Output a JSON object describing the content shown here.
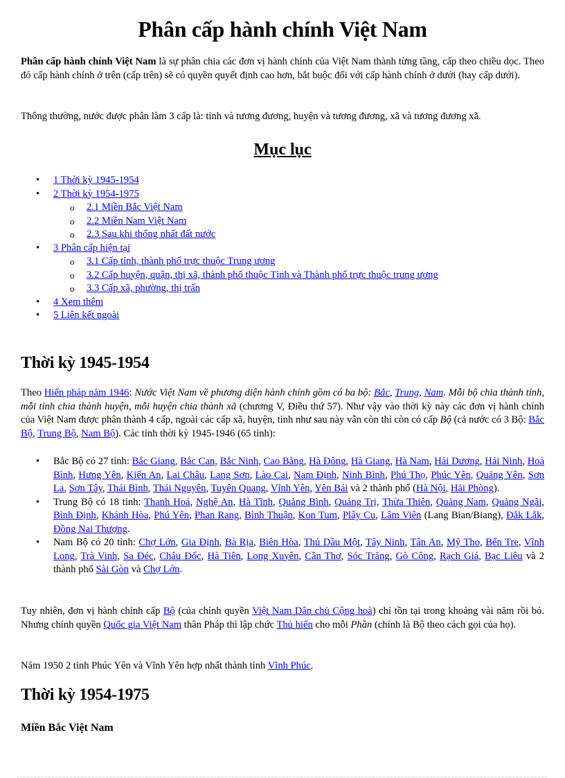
{
  "title": "Phân cấp hành chính Việt Nam",
  "intro": {
    "bold": "Phân cấp hành chính Việt Nam",
    "rest": " là sự phân chia các đơn vị hành chính của Việt Nam thành từng tầng, cấp theo chiều dọc. Theo đó cấp hành chính ở trên (cấp trên) sẽ có quyền quyết định cao hơn, bắt buộc đối với cấp hành chính ở dưới (hay cấp dưới).",
    "second": "Thông thường, nước được phân làm 3 cấp là: tỉnh và tương đương, huyện và tương đương, xã và tương đương xã."
  },
  "toc": {
    "title": "Mục lục",
    "items": [
      {
        "label": "1 Thời kỳ 1945-1954",
        "level": 1
      },
      {
        "label": "2 Thời kỳ 1954-1975",
        "level": 1
      },
      {
        "label": "2.1 Miền Bắc Việt Nam",
        "level": 2
      },
      {
        "label": "2.2 Miền Nam Việt Nam",
        "level": 2
      },
      {
        "label": "2.3 Sau khi thống nhất đất nước",
        "level": 2
      },
      {
        "label": "3 Phân cấp hiện tại",
        "level": 1
      },
      {
        "label": "3.1 Cấp tỉnh, thành phố trực thuộc Trung ương",
        "level": 2
      },
      {
        "label": "3.2 Cấp huyện, quận, thị xã, thành phố thuộc Tỉnh và Thành phố trực thuộc trung ương",
        "level": 2
      },
      {
        "label": "3.3 Cấp xã, phường, thị trấn",
        "level": 2
      },
      {
        "label": "4 Xem thêm",
        "level": 1
      },
      {
        "label": "5 Liên kết ngoài",
        "level": 1
      }
    ]
  },
  "section1": {
    "heading": "Thời kỳ 1945-1954",
    "p1": {
      "t1": "Theo ",
      "link_constitution": "Hiến pháp năm 1946",
      "t2": ": ",
      "i1": "Nước Việt Nam về phương diện hành chính gồm có ba bộ: ",
      "link_bac": "Bắc",
      "link_trung": "Trung",
      "link_nam": "Nam",
      "i2": ". Mỗi bộ chia thành tỉnh, mỗi tỉnh chia thành huyện, mỗi huyện chia thành xã",
      "t3": " (chương V, Điều thứ 57). Như vậy vào thời kỳ này các đơn vị hành chính của Việt Nam được phân thành 4 cấp, ngoài các cấp xã, huyện, tỉnh như sau này vẫn còn thì còn có cấp ",
      "i3": "Bộ",
      "t4": " (cả nước có 3 Bộ: ",
      "link_bacbo": "Bắc Bộ",
      "link_trungbo": "Trung Bộ",
      "link_nambo": "Nam Bộ",
      "t5": "). Các tỉnh thời kỳ 1945-1946 (65 tỉnh):"
    },
    "regions": [
      {
        "prefix": "Bắc Bộ có 27 tỉnh: ",
        "provinces": [
          "Bắc Giang",
          "Bắc Can",
          "Bắc Ninh",
          "Cao Bằng",
          "Hà Đông",
          "Hà Giang",
          "Hà Nam",
          "Hải Dương",
          "Hải Ninh",
          "Hoà Bình",
          "Hưng Yên",
          "Kiến An",
          "Lai Châu",
          "Lang Sơn",
          "Lào Cai",
          "Nam Định",
          "Ninh Bình",
          "Phú Thọ",
          "Phúc Yên",
          "Quảng Yên",
          "Sơn La",
          "Sơn Tây",
          "Thái Bình",
          "Thái Nguyên",
          "Tuyên Quang",
          "Vĩnh Yên",
          "Yên Bái"
        ],
        "mid": " và 2 thành phố (",
        "cities": [
          "Hà Nội",
          "Hải Phòng"
        ],
        "suffix": ")."
      },
      {
        "prefix": "Trung Bộ có 18 tỉnh: ",
        "provinces": [
          "Thanh Hoá",
          "Nghệ An",
          "Hà Tĩnh",
          "Quảng Bình",
          "Quảng Trị",
          "Thừa Thiên",
          "Quảng Nam",
          "Quảng Ngãi",
          "Bình Định",
          "Khánh Hòa",
          "Phú Yên",
          "Phan Rang",
          "Bình Thuận",
          "Kon Tum",
          "Plây Cu",
          "Lâm Viên"
        ],
        "mid": " (Lang Bian/Biang), ",
        "cities": [
          "Đắk Lắk",
          "Đồng Nai Thượng"
        ],
        "suffix": "."
      },
      {
        "prefix": "Nam Bộ có 20 tỉnh: ",
        "provinces": [
          "Chợ Lớn",
          "Gia Định",
          "Bà Rịa",
          "Biên Hòa",
          "Thủ Dầu Một",
          "Tây Ninh",
          "Tân An",
          "Mỹ Tho",
          "Bến Tre",
          "Vĩnh Long",
          "Trà Vinh",
          "Sa Đéc",
          "Châu Đốc",
          "Hà Tiên",
          "Long Xuyên",
          "Cần Thơ",
          "Sóc Trăng",
          "Gò Công",
          "Rạch Giá",
          "Bạc Liêu"
        ],
        "mid": " và 2 thành phố ",
        "cities": [
          "Sài Gòn",
          "Chợ Lớn"
        ],
        "city_sep": " và ",
        "suffix": "."
      }
    ],
    "p2": {
      "t1": "Tuy nhiên, đơn vị hành chính cấp ",
      "link_bo": "Bộ",
      "t2": " (của chính quyền ",
      "link_vndcch": "Việt Nam Dân chủ Cộng hoà",
      "t3": ") chỉ tồn tại trong khoảng vài năm rồi bỏ. Nhưng chính quyền ",
      "link_qgvn": "Quốc gia Việt Nam",
      "t4": " thân Pháp thì lập chức ",
      "link_thuhien": "Thủ hiến",
      "t5": " cho mỗi ",
      "i1": "Phần",
      "t6": " (chính là Bộ theo cách gọi của họ)."
    },
    "p3": {
      "t1": "Năm 1950 2 tỉnh Phúc Yên và Vĩnh Yên hợp nhất thành tỉnh ",
      "link_vinhphuc": "Vĩnh Phúc",
      "t2": "."
    }
  },
  "section2": {
    "heading": "Thời kỳ 1954-1975",
    "sub_heading": "Miền Bắc Việt Nam"
  },
  "colors": {
    "link": "#0000ee",
    "text": "#000000"
  }
}
